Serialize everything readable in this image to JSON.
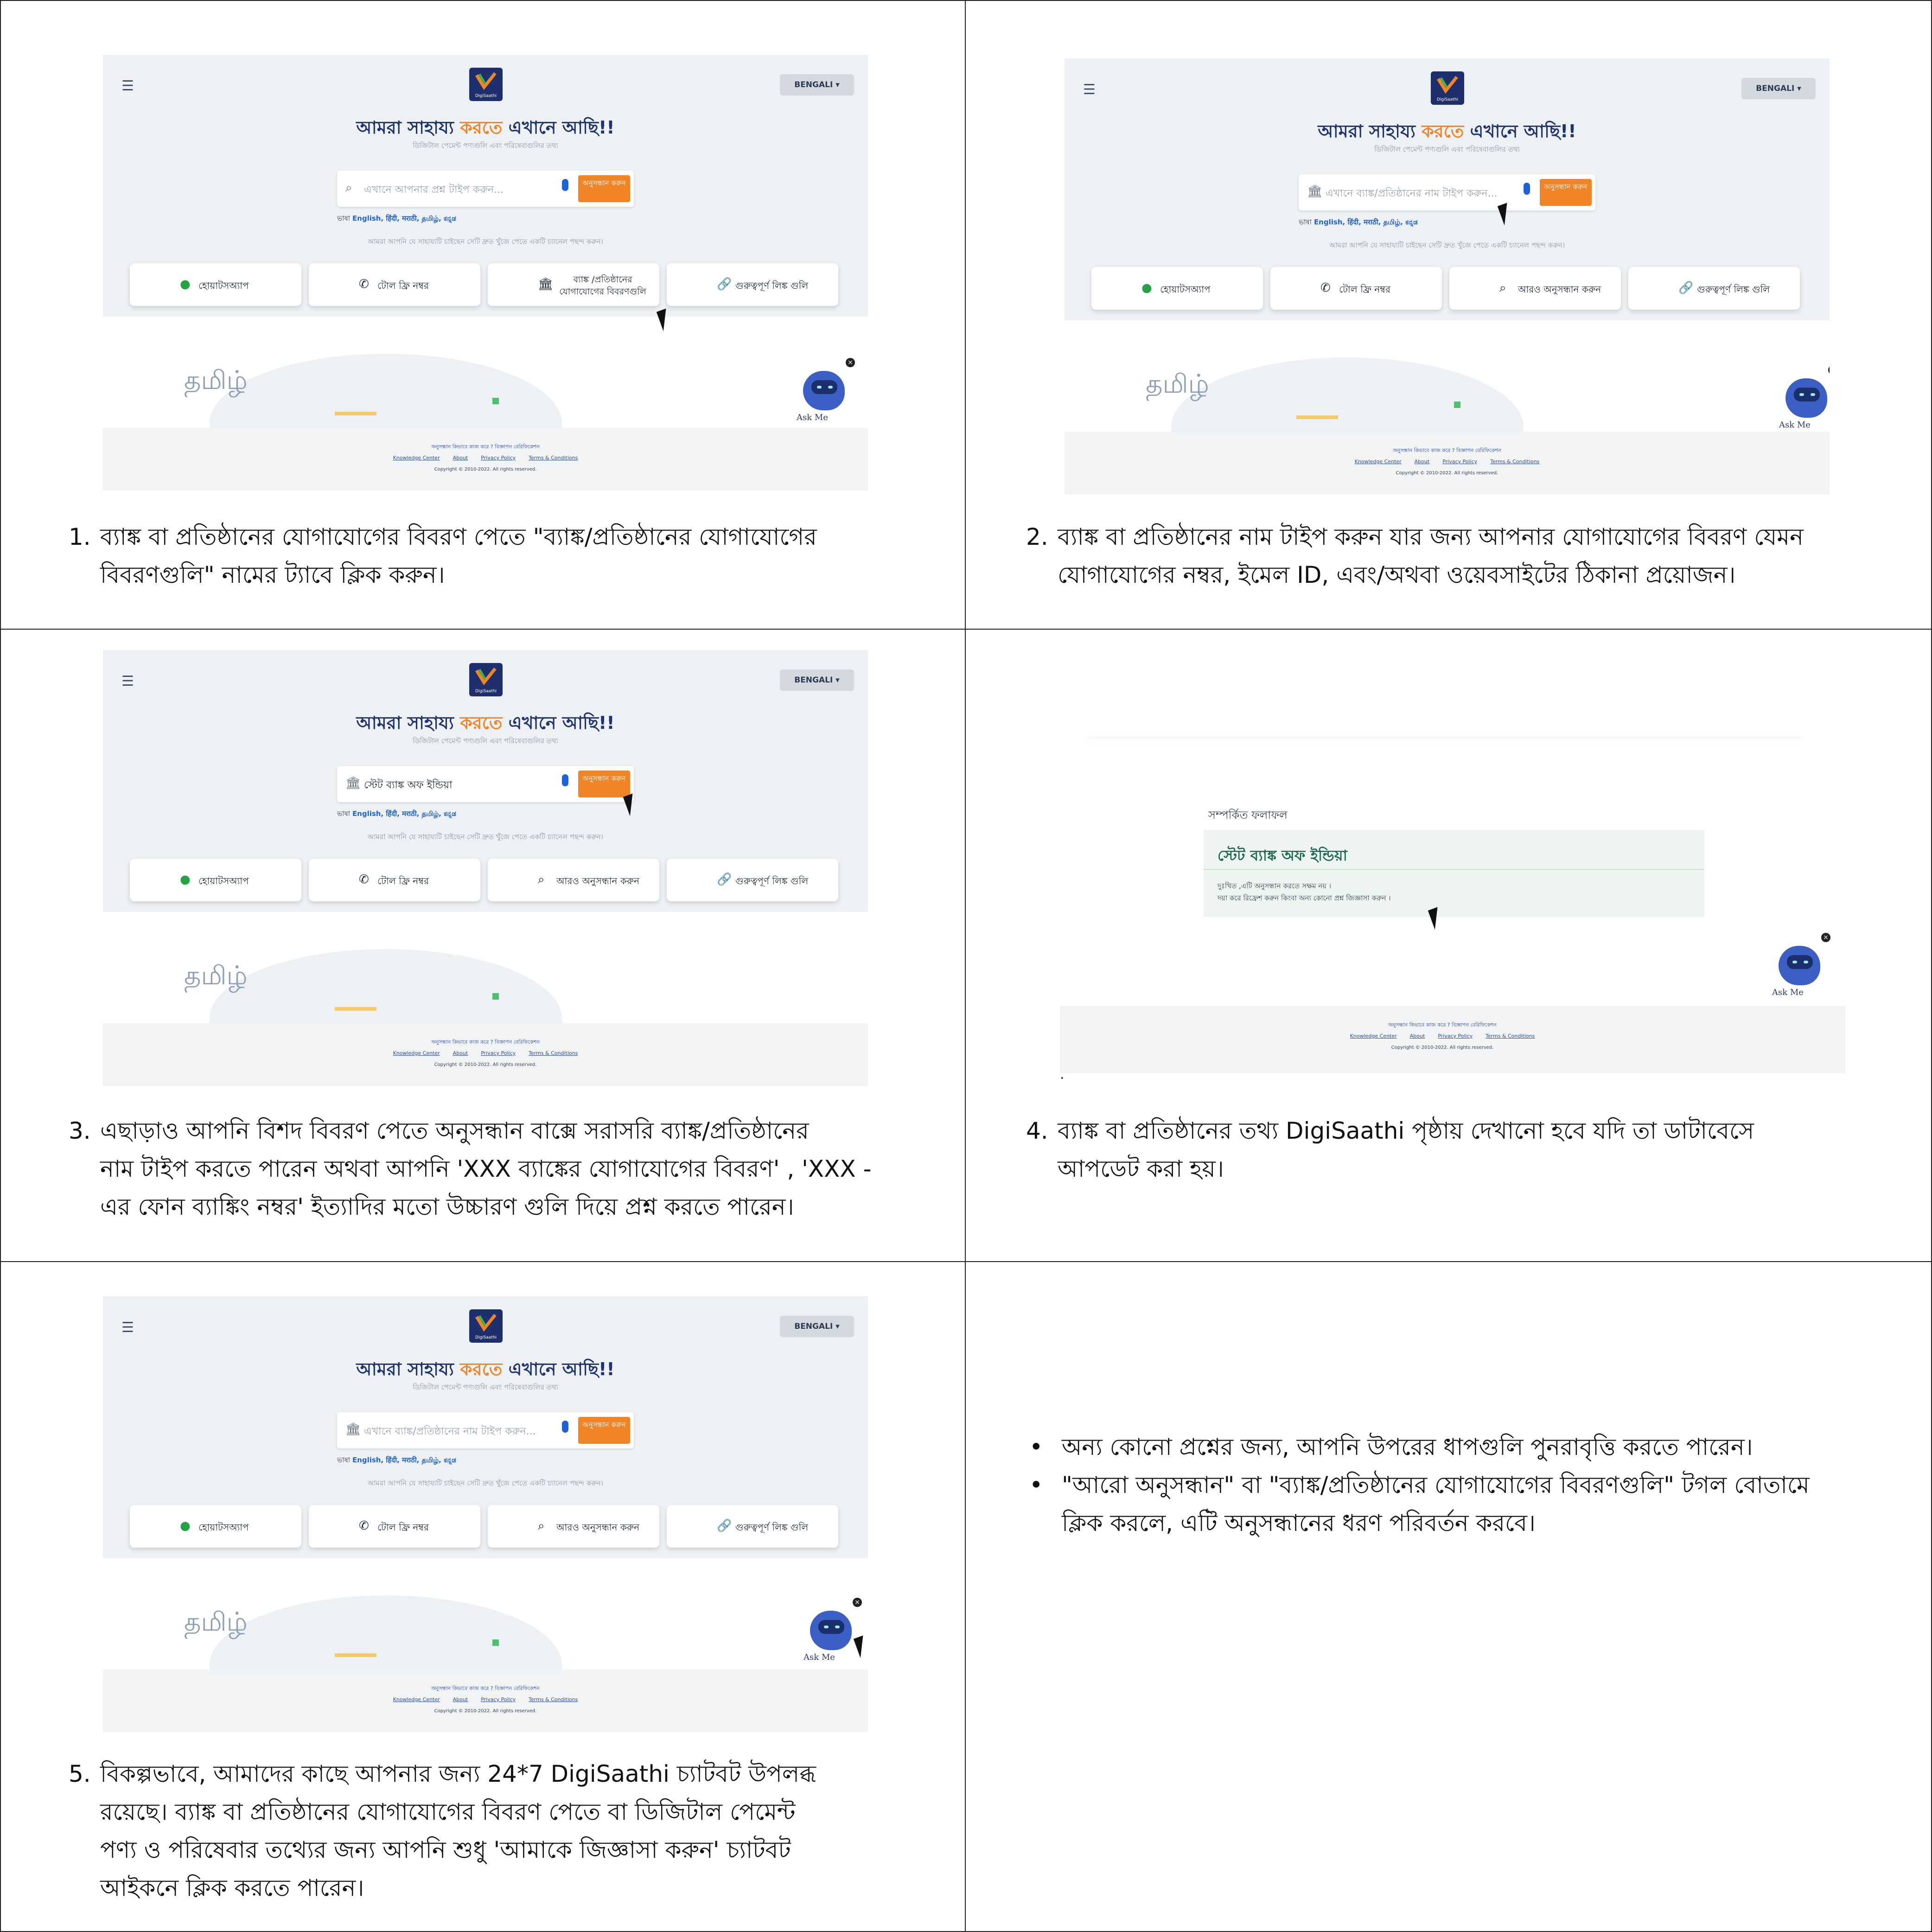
{
  "app": {
    "menu_icon": "☰",
    "logo_text": "DigiSaathi",
    "language_button": "BENGALI ▾",
    "title_part1": "আমরা সাহায্য ",
    "title_highlight": "করতে",
    "title_part2": " এখানে আছি!!",
    "subtitle": "ডিজিটাল পেমেন্ট পণ্যগুলি এবং পরিষেবাগুলির তথ্য",
    "search_placeholder_question": "এখানে আপনার প্রশ্ন টাইপ করুন...",
    "search_placeholder_bank": "এখানে ব্যাঙ্ক/প্রতিষ্ঠানের নাম টাইপ করুন...",
    "search_value_sbi": "স্টেট ব্যাঙ্ক অফ ইন্ডিয়া",
    "search_button": "অনুসন্ধান করুন",
    "languages_label": "ভাষা",
    "languages_list": "English, हिंदी, मराठी, தமிழ், ಕನ್ನಡ",
    "channel_note": "আমরা আপনি যে সাহায্যটি চাইছেন সেটি দ্রুত খুঁজে পেতে একটি চ্যানেল পছন্দ করুন।",
    "tab_whatsapp": "হোয়াটসঅ্যাপ",
    "tab_tollfree": "টোল ফ্রি নম্বর",
    "tab_bank_contact": "ব্যাঙ্ক /প্রতিষ্ঠানের যোগাযোগের বিবরণগুলি",
    "tab_more_search": "আরও অনুসন্ধান করুন",
    "tab_links": "গুরুত্বপূর্ণ লিঙ্ক গুলি",
    "tamil_word": "தமிழ்",
    "footer_line1": "অনুসন্ধান কিভাবে কাজ করে ?    বিজ্ঞাপন বেরিফিকেশন",
    "footer_links": [
      "Knowledge Center",
      "About",
      "Privacy Policy",
      "Terms & Conditions"
    ],
    "footer_copyright": "Copyright © 2010-2022. All rights reserved.",
    "ask_me": "Ask Me"
  },
  "result": {
    "label": "সম্পর্কিত ফলাফল",
    "bank_name": "স্টেট ব্যাঙ্ক অফ ইন্ডিয়া",
    "line1": "দুঃখিত ,এটি অনুসন্ধান করতে সক্ষম নয় ।",
    "line2": "দয়া করে রিফ্রেশ করুন কিংবা অন্য কোনো প্রশ্ন জিজ্ঞাসা করুন ।",
    "dot": "."
  },
  "steps": [
    {
      "num": "1.",
      "lines": [
        "ব্যাঙ্ক বা প্রতিষ্ঠানের যোগাযোগের বিবরণ পেতে \"ব্যাঙ্ক/প্রতিষ্ঠানের যোগাযোগের",
        "বিবরণগুলি\"  নামের ট্যাবে ক্লিক করুন।"
      ]
    },
    {
      "num": "2.",
      "lines": [
        "ব্যাঙ্ক বা প্রতিষ্ঠানের নাম টাইপ করুন যার জন্য আপনার যোগাযোগের বিবরণ যেমন",
        "যোগাযোগের নম্বর, ইমেল ID, এবং/অথবা ওয়েবসাইটের ঠিকানা প্রয়োজন।"
      ]
    },
    {
      "num": "3.",
      "lines": [
        "এছাড়াও আপনি বিশদ বিবরণ পেতে অনুসন্ধান বাক্সে সরাসরি ব্যাঙ্ক/প্রতিষ্ঠানের",
        "নাম টাইপ করতে পারেন অথবা আপনি 'XXX ব্যাঙ্কের যোগাযোগের বিবরণ' , 'XXX -",
        "এর ফোন ব্যাঙ্কিং নম্বর' ইত্যাদির মতো উচ্চারণ গুলি দিয়ে প্রশ্ন করতে পারেন।"
      ]
    },
    {
      "num": "4.",
      "lines": [
        "ব্যাঙ্ক বা প্রতিষ্ঠানের তথ্য DigiSaathi পৃষ্ঠায় দেখানো হবে যদি তা ডাটাবেসে",
        "আপডেট করা হয়।"
      ]
    },
    {
      "num": "5.",
      "lines": [
        "বিকল্পভাবে, আমাদের কাছে আপনার জন্য 24*7 DigiSaathi চ্যাটবট উপলব্ধ",
        "রয়েছে। ব্যাঙ্ক বা প্রতিষ্ঠানের যোগাযোগের বিবরণ পেতে বা ডিজিটাল পেমেন্ট",
        "পণ্য ও পরিষেবার তথ্যের জন্য আপনি শুধু 'আমাকে জিজ্ঞাসা করুন' চ্যাটবট",
        "আইকনে ক্লিক করতে পারেন।"
      ]
    }
  ],
  "bullets": [
    {
      "lines": [
        "অন্য কোনো প্রশ্নের জন্য, আপনি উপরের ধাপগুলি পুনরাবৃত্তি করতে পারেন।"
      ]
    },
    {
      "lines": [
        "\"আরো অনুসন্ধান\" বা \"ব্যাঙ্ক/প্রতিষ্ঠানের যোগাযোগের বিবরণগুলি\" টগল বোতামে",
        "ক্লিক করলে, এটি অনুসন্ধানের ধরণ পরিবর্তন করবে।"
      ]
    }
  ],
  "colors": {
    "accent_orange": "#f08528",
    "brand_navy": "#1e3470",
    "hero_bg": "#eef1f4"
  }
}
